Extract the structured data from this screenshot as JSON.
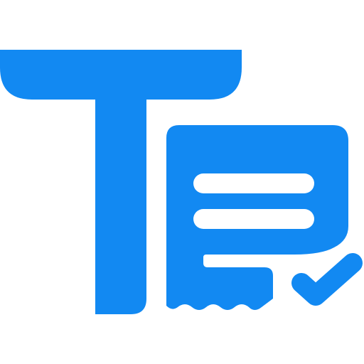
{
  "icon": {
    "name": "text-document-check-icon",
    "parts": [
      "letter-t-glyph",
      "document-sheet",
      "text-lines",
      "checkmark"
    ],
    "colors": {
      "primary": "#1289f2",
      "background": "#ffffff",
      "line": "#ffffff"
    }
  }
}
